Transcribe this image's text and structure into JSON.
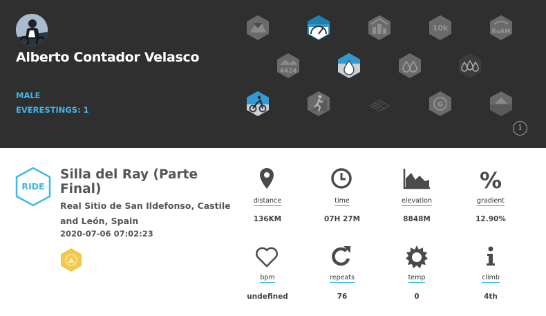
{
  "athlete": {
    "name": "Alberto Contador Velasco",
    "gender": "MALE",
    "everestings": "EVERESTINGS: 1"
  },
  "badges_header": [
    {
      "icon": "mountain-badge-icon",
      "active": false
    },
    {
      "icon": "gauge-badge-icon",
      "active": true
    },
    {
      "icon": "city-badge-icon",
      "active": false
    },
    {
      "icon": "10k-badge-icon",
      "active": false,
      "text": "10k"
    },
    {
      "icon": "roam-badge-icon",
      "active": false,
      "text": "RoAM"
    },
    {
      "icon": "4424-badge-icon",
      "active": false,
      "text": "4424"
    },
    {
      "icon": "single-drop-badge-icon",
      "active": true
    },
    {
      "icon": "double-drop-badge-icon",
      "active": false
    },
    {
      "icon": "triple-drop-badge-icon",
      "active": false
    },
    {
      "icon": "cyclist-badge-icon",
      "active": true
    },
    {
      "icon": "runner-badge-icon",
      "active": false
    },
    {
      "icon": "grid-badge-icon",
      "active": false
    },
    {
      "icon": "circle-g-badge-icon",
      "active": false,
      "text": "G"
    },
    {
      "icon": "mountain-box-badge-icon",
      "active": false
    }
  ],
  "ride": {
    "type_label": "RIDE",
    "title": "Silla del Ray (Parte Final)",
    "location": "Real Sitio de San Ildefonso, Castile and León, Spain",
    "datetime": "2020-07-06 07:02:23",
    "badge_icon": "gold-everest-badge-icon"
  },
  "stats": [
    {
      "icon": "location-pin-icon",
      "label": "distance",
      "value": "136KM"
    },
    {
      "icon": "clock-icon",
      "label": "time",
      "value": "07H 27M"
    },
    {
      "icon": "elevation-chart-icon",
      "label": "elevation",
      "value": "8848M"
    },
    {
      "icon": "percent-icon",
      "label": "gradient",
      "value": "12.90%"
    },
    {
      "icon": "heart-icon",
      "label": "bpm",
      "value": "undefined"
    },
    {
      "icon": "refresh-icon",
      "label": "repeats",
      "value": "76"
    },
    {
      "icon": "sun-icon",
      "label": "temp",
      "value": "0"
    },
    {
      "icon": "info-icon",
      "label": "climb",
      "value": "4th"
    }
  ],
  "colors": {
    "header_bg": "#2f2f2f",
    "accent": "#3fb7e8",
    "badge_inactive": "#6a6a6a",
    "gold": "#f2c94c"
  }
}
